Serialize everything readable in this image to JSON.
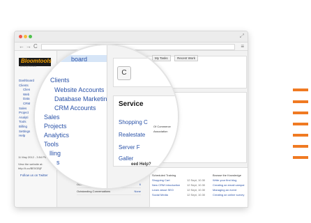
{
  "browser": {
    "menu_icon": "hamburger-icon",
    "back": "←",
    "forward": "→",
    "reload": "C",
    "expand": "⤢"
  },
  "app": {
    "logo": "Bloomtools",
    "logo_tagline": "growing business",
    "sidebar": [
      "Dashboard",
      "Clients",
      "Clien",
      "Web",
      "Data",
      "CRM",
      "Sales",
      "Project",
      "Analyti",
      "Tools",
      "Billing",
      "Settings",
      "Help"
    ],
    "side_date": "11 May 2012 - 3:54 PM",
    "side_note": "View the website at: http://t.co/BE0GBjF",
    "twitter": "Follow us on Twitter"
  },
  "tabs": [
    "My Tasks",
    "Recent Work"
  ],
  "zoom": {
    "nav_top": "board",
    "nav_items": [
      "nts",
      "Clients",
      "Website Accounts",
      "Database Marketing",
      "CRM Accounts",
      "Sales",
      "Projects",
      "Analytics",
      "Tools",
      "lling",
      "s"
    ],
    "c_label": "C",
    "service_title": "Service",
    "service_rows": [
      "Shopping C",
      "Realestate",
      "Server F",
      "Galler"
    ],
    "small_rows": [
      "Of Commerce",
      "Association"
    ],
    "help_title": "eed Help?"
  },
  "scheduled": {
    "title": "Scheduled Training",
    "rows": [
      {
        "name": "Shopping Cart",
        "date": "12 Sept, 10.30"
      },
      {
        "name": "New CRM Introduction",
        "date": "12 Sept, 10.30"
      },
      {
        "name": "Learn about SEO",
        "date": "12 Sept, 10.30"
      },
      {
        "name": "Social Media",
        "date": "12 Sept, 10.30"
      }
    ]
  },
  "knowledge": {
    "title": "Browse the Knowledge",
    "rows": [
      "Write your first blog",
      "Creating an email campai",
      "Managing an event",
      "Creating an online survey"
    ]
  },
  "bottom": [
    {
      "label": "Outstanding Applications",
      "value": "6"
    },
    {
      "label": "Outstanding Conversations",
      "value": "None"
    }
  ]
}
